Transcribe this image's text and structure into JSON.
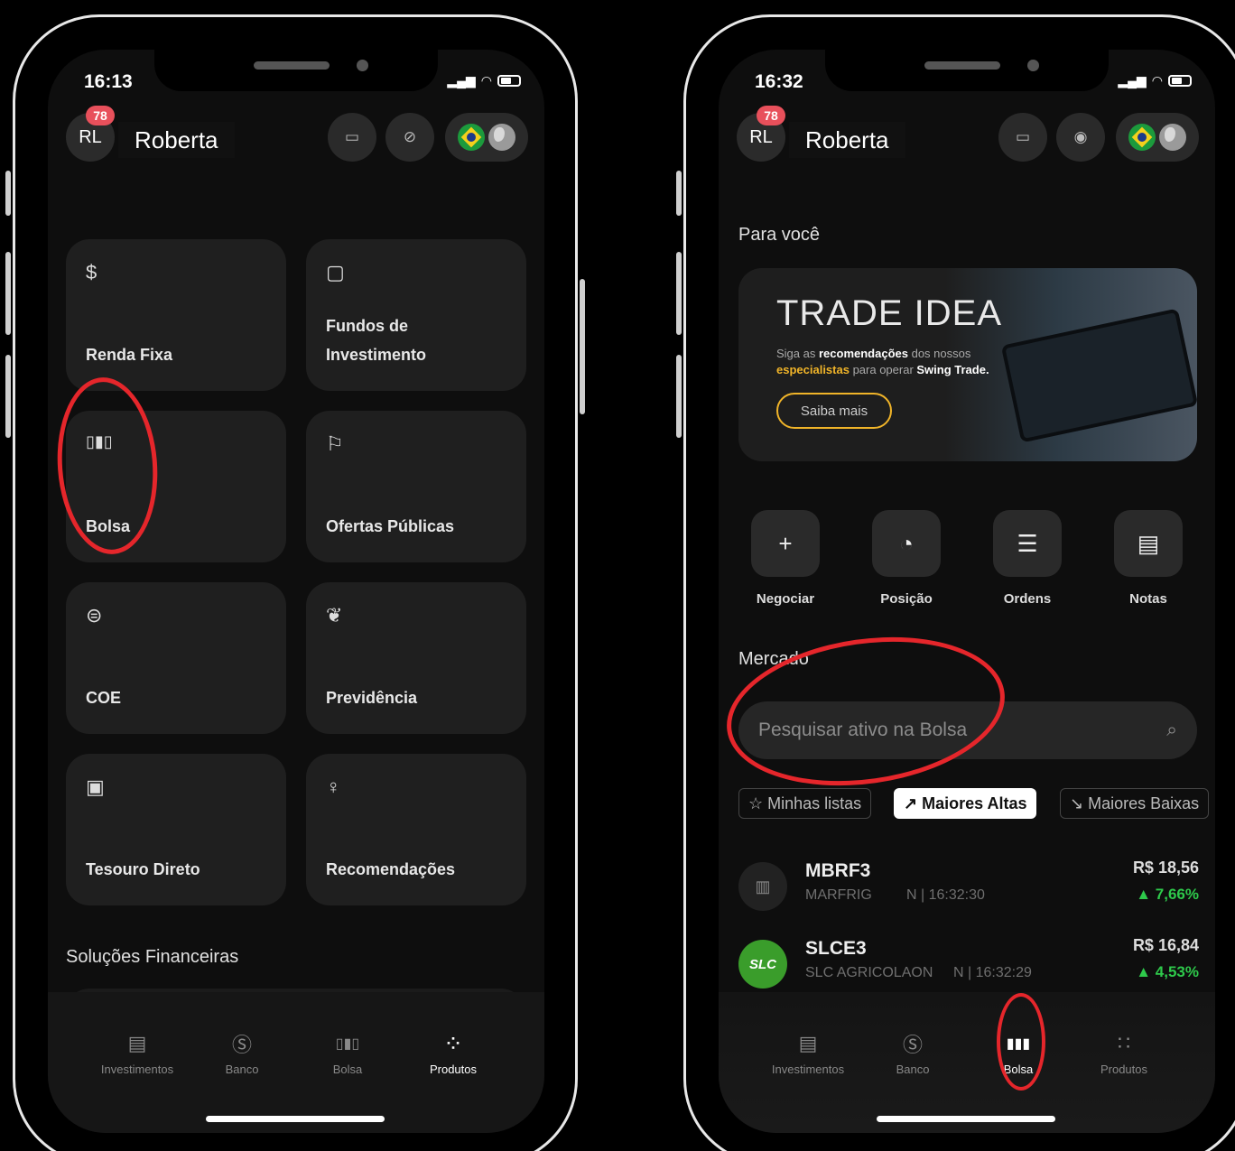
{
  "colors": {
    "annotation": "#e5262b",
    "accent_gold": "#f0b429",
    "gain_green": "#2ec94b"
  },
  "left": {
    "time": "16:13",
    "avatar_initials": "RL",
    "badge_count": "78",
    "username": "Roberta",
    "cards": [
      {
        "label": "Renda Fixa",
        "icon": "money-bag-icon"
      },
      {
        "label": "Fundos de Investimento",
        "icon": "briefcase-icon"
      },
      {
        "label": "Bolsa",
        "icon": "candlestick-icon"
      },
      {
        "label": "Ofertas Públicas",
        "icon": "flag-icon"
      },
      {
        "label": "COE",
        "icon": "coins-stack-icon"
      },
      {
        "label": "Previdência",
        "icon": "leaf-icon"
      },
      {
        "label": "Tesouro Direto",
        "icon": "safe-icon"
      },
      {
        "label": "Recomendações",
        "icon": "lightbulb-icon"
      }
    ],
    "section_title": "Soluções Financeiras",
    "tabs": [
      {
        "label": "Investimentos",
        "icon": "chart-icon"
      },
      {
        "label": "Banco",
        "icon": "dollar-icon"
      },
      {
        "label": "Bolsa",
        "icon": "candlestick-icon"
      },
      {
        "label": "Produtos",
        "icon": "grid-icon"
      }
    ]
  },
  "right": {
    "time": "16:32",
    "avatar_initials": "RL",
    "badge_count": "78",
    "username": "Roberta",
    "for_you_title": "Para você",
    "banner": {
      "title": "TRADE IDEA",
      "line1_pre": "Siga as ",
      "line1_bold": "recomendações",
      "line1_post": " dos nossos",
      "line2_gold": "especialistas",
      "line2_mid": " para operar ",
      "line2_bold": "Swing Trade.",
      "cta": "Saiba mais"
    },
    "quick_actions": [
      {
        "label": "Negociar",
        "icon": "plus-icon"
      },
      {
        "label": "Posição",
        "icon": "pie-chart-icon"
      },
      {
        "label": "Ordens",
        "icon": "list-icon"
      },
      {
        "label": "Notas",
        "icon": "document-icon"
      }
    ],
    "market_title": "Mercado",
    "search_placeholder": "Pesquisar ativo na Bolsa",
    "chips": [
      {
        "label": "Minhas listas",
        "icon": "star-icon"
      },
      {
        "label": "Maiores Altas",
        "icon": "trend-up-icon"
      },
      {
        "label": "Maiores Baixas",
        "icon": "trend-down-icon"
      }
    ],
    "stocks": [
      {
        "symbol": "MBRF3",
        "name": "MARFRIG",
        "time": "N | 16:32:30",
        "price": "R$ 18,56",
        "change": "▲ 7,66%"
      },
      {
        "symbol": "SLCE3",
        "name": "SLC AGRICOLAON",
        "time": "N | 16:32:29",
        "price": "R$ 16,84",
        "change": "▲ 4,53%",
        "logo_text": "SLC"
      }
    ],
    "tabs": [
      {
        "label": "Investimentos",
        "icon": "chart-icon"
      },
      {
        "label": "Banco",
        "icon": "dollar-icon"
      },
      {
        "label": "Bolsa",
        "icon": "candlestick-icon"
      },
      {
        "label": "Produtos",
        "icon": "grid-icon"
      }
    ]
  }
}
